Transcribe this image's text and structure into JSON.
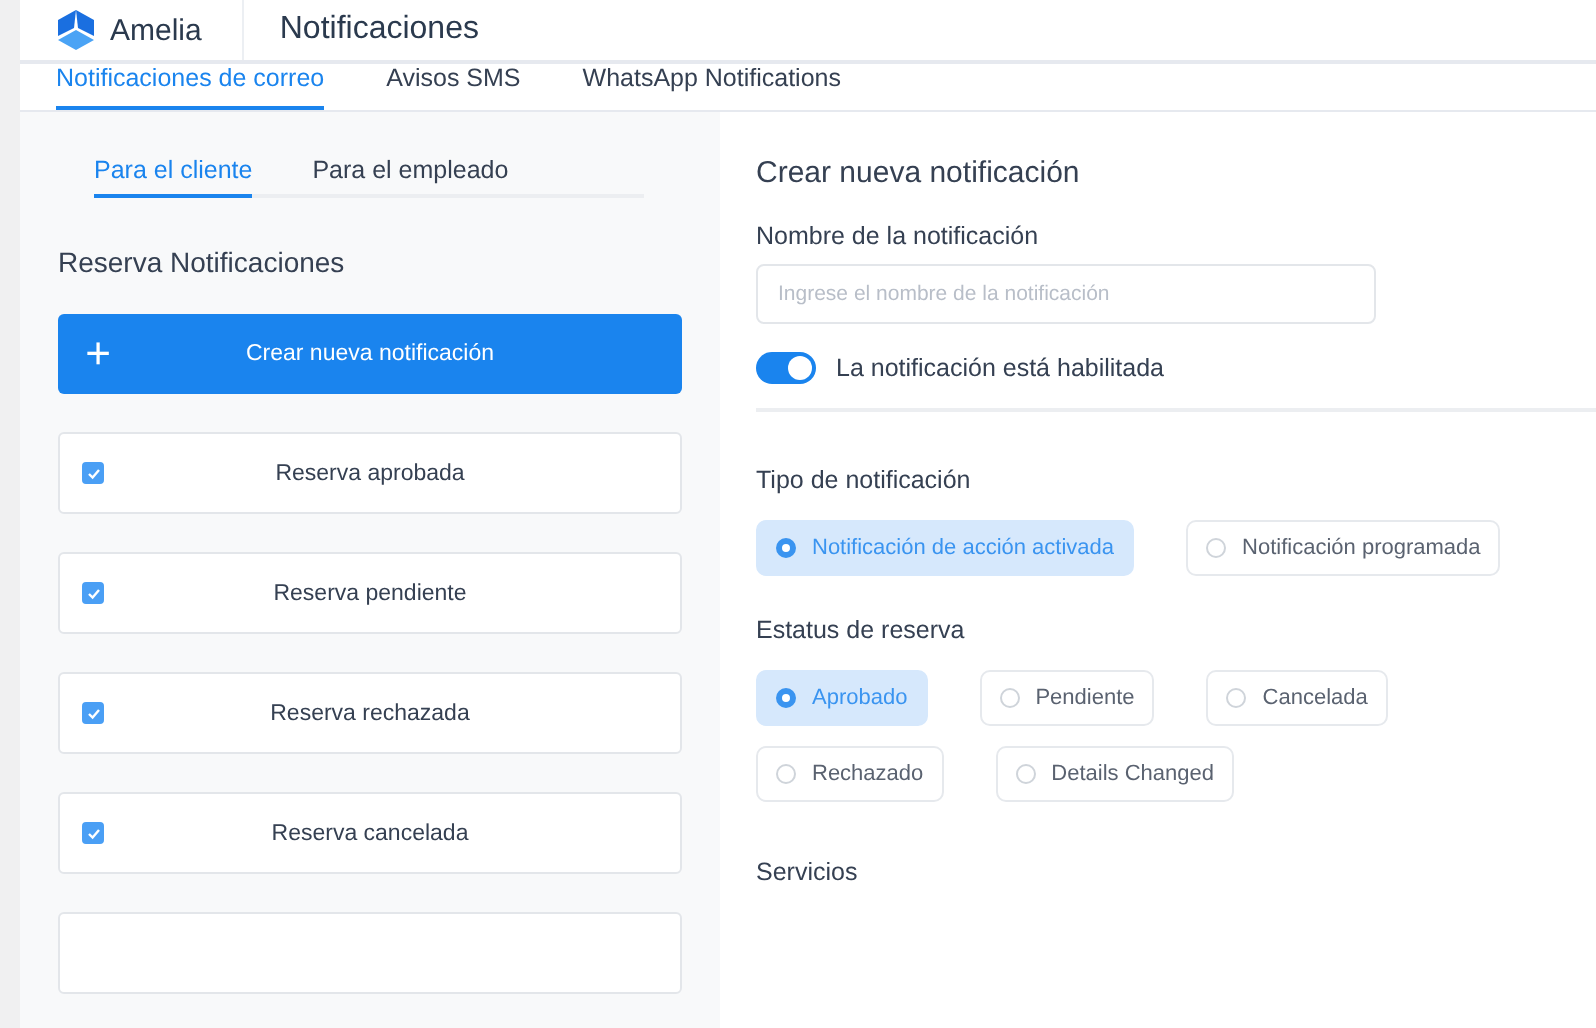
{
  "header": {
    "brand": "Amelia",
    "title": "Notificaciones"
  },
  "tabs": [
    {
      "label": "Notificaciones de correo",
      "selected": true
    },
    {
      "label": "Avisos SMS",
      "selected": false
    },
    {
      "label": "WhatsApp Notifications",
      "selected": false
    }
  ],
  "sidebar": {
    "subtabs": [
      {
        "label": "Para el cliente",
        "selected": true
      },
      {
        "label": "Para el empleado",
        "selected": false
      }
    ],
    "section_title": "Reserva Notificaciones",
    "create_button": {
      "icon": "+",
      "label": "Crear nueva notificación"
    },
    "items": [
      {
        "label": "Reserva aprobada",
        "checked": true
      },
      {
        "label": "Reserva pendiente",
        "checked": true
      },
      {
        "label": "Reserva rechazada",
        "checked": true
      },
      {
        "label": "Reserva cancelada",
        "checked": true
      }
    ]
  },
  "form": {
    "title": "Crear nueva notificación",
    "name_label": "Nombre de la notificación",
    "name_field": {
      "placeholder": "Ingrese el nombre de la notificación"
    },
    "enabled_toggle": {
      "label": "La notificación está habilitada",
      "on": true
    },
    "type_label": "Tipo de notificación",
    "types": [
      {
        "label": "Notificación de acción activada",
        "selected": true
      },
      {
        "label": "Notificación programada",
        "selected": false
      }
    ],
    "status_label": "Estatus de reserva",
    "statuses": [
      {
        "label": "Aprobado",
        "selected": true
      },
      {
        "label": "Pendiente",
        "selected": false
      },
      {
        "label": "Cancelada",
        "selected": false
      },
      {
        "label": "Rechazado",
        "selected": false
      },
      {
        "label": "Details Changed",
        "selected": false
      }
    ],
    "services_label": "Servicios"
  }
}
